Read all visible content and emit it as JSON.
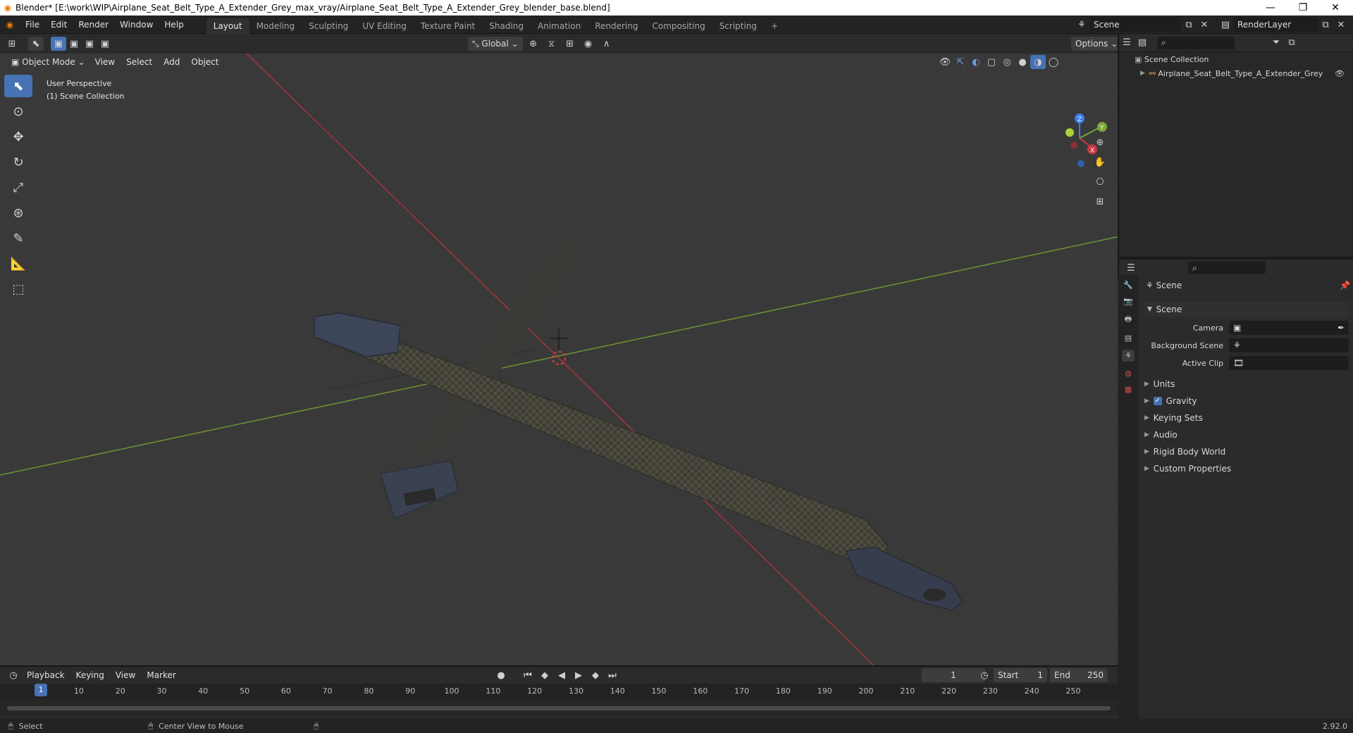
{
  "window": {
    "title": "Blender* [E:\\work\\WIP\\Airplane_Seat_Belt_Type_A_Extender_Grey_max_vray/Airplane_Seat_Belt_Type_A_Extender_Grey_blender_base.blend]",
    "minimize": "—",
    "maximize": "❐",
    "close": "✕"
  },
  "menu": [
    "File",
    "Edit",
    "Render",
    "Window",
    "Help"
  ],
  "workspaces": [
    "Layout",
    "Modeling",
    "Sculpting",
    "UV Editing",
    "Texture Paint",
    "Shading",
    "Animation",
    "Rendering",
    "Compositing",
    "Scripting"
  ],
  "scene_name": "Scene",
  "view_layer": "RenderLayer",
  "viewport_header": {
    "mode": "Object Mode",
    "menus": [
      "View",
      "Select",
      "Add",
      "Object"
    ],
    "transform": "Global",
    "options": "Options"
  },
  "viewport_overlay": {
    "line1": "User Perspective",
    "line2": "(1) Scene Collection"
  },
  "gizmo": {
    "z": "Z",
    "y": "Y",
    "x": "X"
  },
  "outliner": {
    "root": "Scene Collection",
    "items": [
      {
        "label": "Airplane_Seat_Belt_Type_A_Extender_Grey"
      }
    ]
  },
  "properties": {
    "header": "Scene",
    "section": "Scene",
    "fields": [
      {
        "label": "Camera"
      },
      {
        "label": "Background Scene"
      },
      {
        "label": "Active Clip"
      }
    ],
    "panels": [
      {
        "label": "Units",
        "checkbox": false
      },
      {
        "label": "Gravity",
        "checkbox": true
      },
      {
        "label": "Keying Sets",
        "checkbox": false
      },
      {
        "label": "Audio",
        "checkbox": false
      },
      {
        "label": "Rigid Body World",
        "checkbox": false
      },
      {
        "label": "Custom Properties",
        "checkbox": false
      }
    ]
  },
  "timeline": {
    "menus": [
      "Playback",
      "Keying",
      "View",
      "Marker"
    ],
    "current_frame": "1",
    "start_label": "Start",
    "start": "1",
    "end_label": "End",
    "end": "250",
    "ticks": [
      "1",
      "10",
      "20",
      "30",
      "40",
      "50",
      "60",
      "70",
      "80",
      "90",
      "100",
      "110",
      "120",
      "130",
      "140",
      "150",
      "160",
      "170",
      "180",
      "190",
      "200",
      "210",
      "220",
      "230",
      "240",
      "250"
    ]
  },
  "statusbar": {
    "left": "Select",
    "middle": "Center View to Mouse",
    "version": "2.92.0"
  },
  "colors": {
    "accent": "#4772b3",
    "x_axis": "#c93a45",
    "y_axis": "#7aa63a",
    "z_axis": "#3a7ff0"
  }
}
